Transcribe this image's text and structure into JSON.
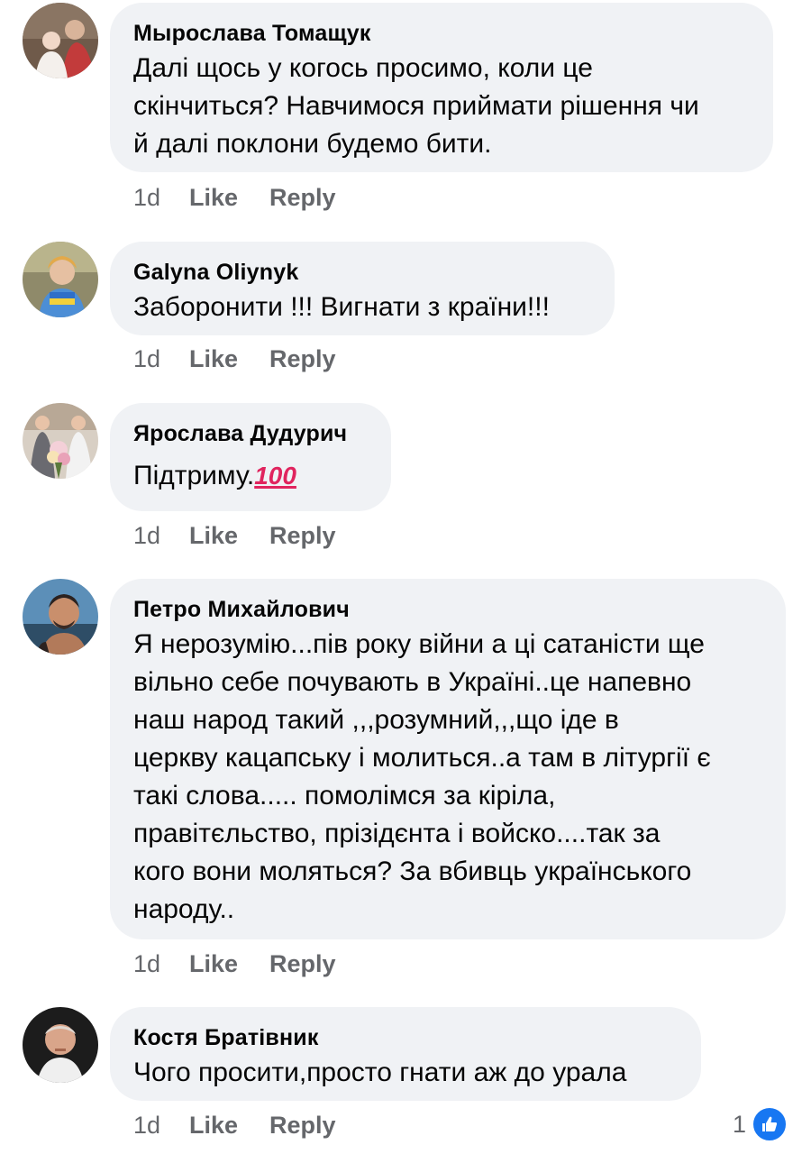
{
  "comments": [
    {
      "author": "Мырослава Томащук",
      "text": "Далі щось у когось просимо, коли це\nскінчиться? Навчимося приймати рішення чи\nй далі поклони будемо бити.",
      "time": "1d",
      "like_label": "Like",
      "reply_label": "Reply"
    },
    {
      "author": "Galyna  Oliynyk",
      "text": "Заборонити !!! Вигнати з країни!!!",
      "time": "1d",
      "like_label": "Like",
      "reply_label": "Reply"
    },
    {
      "author": "Ярослава Дудурич",
      "text": "Підтриму.",
      "emoji": "100",
      "emoji_name": "hundred-points-icon",
      "time": "1d",
      "like_label": "Like",
      "reply_label": "Reply"
    },
    {
      "author": "Петро Михайлович",
      "text": "Я нерозумію...пів року війни а ці сатаністи ще\nвільно себе почувають в Україні..це напевно\nнаш народ такий ,,,розумний,,,що іде в\nцеркву кацапську і молиться..а там в літургії є\nтакі слова..... помолімся за кіріла,\nправітєльство, прізідєнта і войско....так за\nкого вони моляться? За вбивць українського\nнароду..",
      "time": "1d",
      "like_label": "Like",
      "reply_label": "Reply"
    },
    {
      "author": "Костя Братівник",
      "text": "Чого просити,просто гнати аж до урала",
      "time": "1d",
      "like_label": "Like",
      "reply_label": "Reply",
      "reaction_count": "1",
      "reaction_icon": "thumbs-up-icon"
    }
  ],
  "colors": {
    "bubble": "#f0f2f5",
    "meta_text": "#65676b",
    "like_blue": "#1877f2"
  }
}
